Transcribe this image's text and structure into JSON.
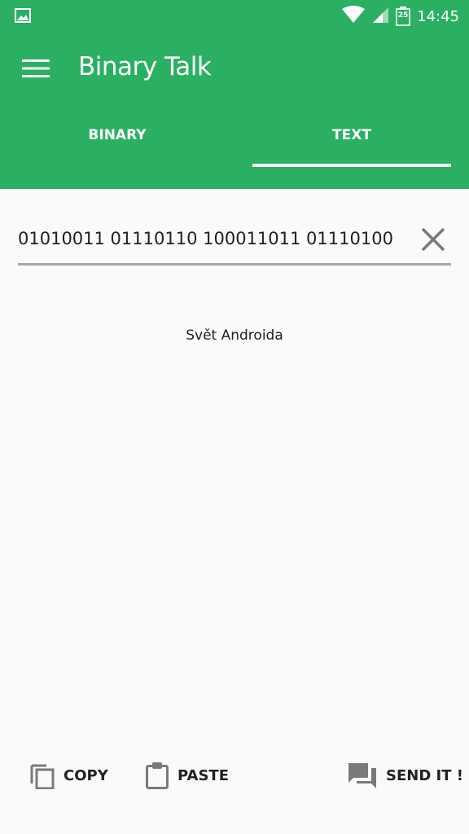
{
  "status_bar": {
    "time": "14:45",
    "calendar_day": "25",
    "icons": [
      "image-icon",
      "wifi-icon",
      "signal-icon",
      "calendar-icon"
    ]
  },
  "toolbar": {
    "title": "Binary Talk",
    "menu_icon": "hamburger-menu-icon"
  },
  "tabs": [
    {
      "label": "BINARY",
      "selected": false
    },
    {
      "label": "TEXT",
      "selected": true
    }
  ],
  "input": {
    "value": "01010011 01110110 100011011 01110100"
  },
  "output": {
    "text": "Svět Androida"
  },
  "actions": {
    "copy_label": "COPY",
    "paste_label": "PASTE",
    "send_label": "SEND IT !"
  },
  "colors": {
    "primary": "#2bb063",
    "background": "#fafafa",
    "text": "#212121",
    "icon_gray": "#7a7a7a"
  }
}
